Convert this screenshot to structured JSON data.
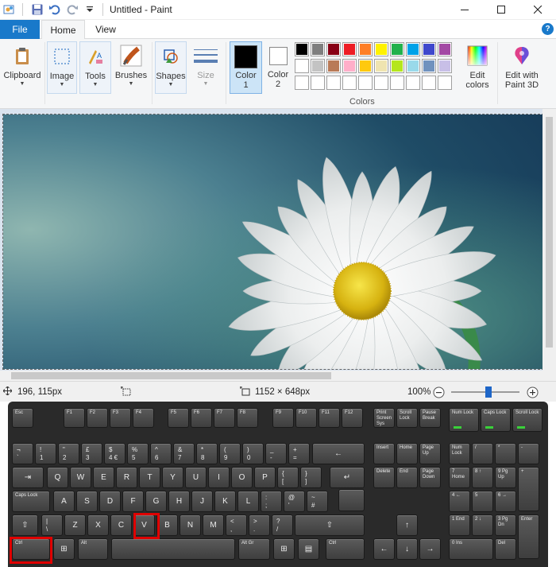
{
  "window": {
    "title": "Untitled - Paint"
  },
  "tabs": {
    "file": "File",
    "home": "Home",
    "view": "View",
    "help": "?"
  },
  "ribbon": {
    "clipboard": "Clipboard",
    "image": "Image",
    "tools": "Tools",
    "brushes": "Brushes",
    "shapes": "Shapes",
    "size": "Size",
    "color1_line1": "Color",
    "color1_line2": "1",
    "color2_line1": "Color",
    "color2_line2": "2",
    "edit_colors_line1": "Edit",
    "edit_colors_line2": "colors",
    "paint3d_line1": "Edit with",
    "paint3d_line2": "Paint 3D",
    "colors_caption": "Colors",
    "color1_value": "#000000",
    "color2_value": "#ffffff",
    "palette_row1": [
      "#000000",
      "#7f7f7f",
      "#880015",
      "#ed1c24",
      "#ff7f27",
      "#fff200",
      "#22b14c",
      "#00a2e8",
      "#3f48cc",
      "#a349a4"
    ],
    "palette_row2": [
      "#ffffff",
      "#c3c3c3",
      "#b97a57",
      "#ffaec9",
      "#ffc90e",
      "#efe4b0",
      "#b5e61d",
      "#99d9ea",
      "#7092be",
      "#c8bfe7"
    ],
    "palette_row3": [
      "#ffffff",
      "#ffffff",
      "#ffffff",
      "#ffffff",
      "#ffffff",
      "#ffffff",
      "#ffffff",
      "#ffffff",
      "#ffffff",
      "#ffffff"
    ]
  },
  "status": {
    "cursor_pos": "196, 115px",
    "image_size": "1152 × 648px",
    "zoom": "100%",
    "zoom_fraction": 0.55
  },
  "keyboard": {
    "row_fn": [
      "Esc",
      "F1",
      "F2",
      "F3",
      "F4",
      "F5",
      "F6",
      "F7",
      "F8",
      "F9",
      "F10",
      "F11",
      "F12"
    ],
    "sys": [
      "Print Screen Sys Rq",
      "Scroll Lock",
      "Pause Break"
    ],
    "locks": [
      "Num Lock",
      "Caps Lock",
      "Scroll Lock"
    ],
    "row_num": [
      [
        "¬",
        "`"
      ],
      [
        "!",
        "1"
      ],
      [
        "\"",
        "2"
      ],
      [
        "£",
        "3"
      ],
      [
        "$",
        "4 €"
      ],
      [
        "%",
        "5"
      ],
      [
        "^",
        "6"
      ],
      [
        "&",
        "7"
      ],
      [
        "*",
        "8"
      ],
      [
        "(",
        "9"
      ],
      [
        ")",
        "0"
      ],
      [
        "_",
        "-"
      ],
      [
        "+",
        "="
      ]
    ],
    "backspace": "←",
    "nav1": [
      "Insert",
      "Home",
      "Page Up"
    ],
    "nav2": [
      "Delete",
      "End",
      "Page Down"
    ],
    "numpad1": [
      "Num Lock",
      "/",
      "*",
      "-"
    ],
    "numpad2": [
      "7 Home",
      "8 ↑",
      "9 Pg Up",
      "+"
    ],
    "numpad3": [
      "4 ←",
      "5",
      "6 →"
    ],
    "numpad4": [
      "1 End",
      "2 ↓",
      "3 Pg Dn",
      "Enter"
    ],
    "numpad5": [
      "0 Ins",
      "Del"
    ],
    "tab": "⇥",
    "row_q": [
      "Q",
      "W",
      "E",
      "R",
      "T",
      "Y",
      "U",
      "I",
      "O",
      "P"
    ],
    "row_q_sym": [
      [
        "{",
        "["
      ],
      [
        "}",
        "]"
      ]
    ],
    "enter": "↵",
    "caps": "Caps Lock",
    "row_a": [
      "A",
      "S",
      "D",
      "F",
      "G",
      "H",
      "J",
      "K",
      "L"
    ],
    "row_a_sym": [
      [
        ":",
        ";"
      ],
      [
        "@",
        "'"
      ],
      [
        "~",
        "#"
      ]
    ],
    "lshift": "⇧",
    "row_z_first": [
      [
        "|",
        "\\"
      ]
    ],
    "row_z": [
      "Z",
      "X",
      "C",
      "V",
      "B",
      "N",
      "M"
    ],
    "row_z_sym": [
      [
        "<",
        ","
      ],
      [
        ">",
        "."
      ],
      [
        "?",
        "/"
      ]
    ],
    "rshift": "⇧",
    "up": "↑",
    "ctrl_l": "Ctrl",
    "win_l": "⊞",
    "alt": "Alt",
    "altgr": "Alt Gr",
    "win_r": "⊞",
    "menu": "▤",
    "ctrl_r": "Ctrl",
    "left": "←",
    "down": "↓",
    "right": "→"
  }
}
